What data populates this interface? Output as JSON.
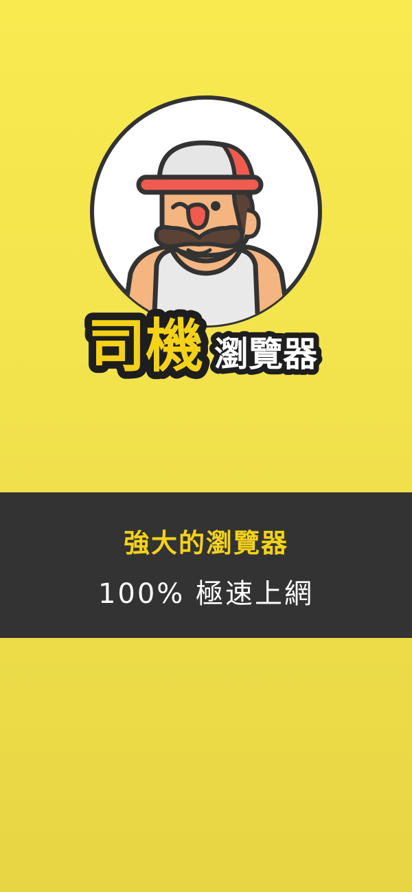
{
  "app": {
    "logo_main": "司機",
    "logo_sub": "瀏覽器"
  },
  "banner": {
    "title": "強大的瀏覽器",
    "subtitle": "100% 極速上網"
  },
  "colors": {
    "background": "#f9ea50",
    "banner_bg": "#333333",
    "accent_yellow": "#f5d21a",
    "cap_red": "#ef5b4f",
    "skin": "#f4b580",
    "outline": "#333333"
  },
  "icons": {
    "mascot": "driver-mascot-icon"
  }
}
